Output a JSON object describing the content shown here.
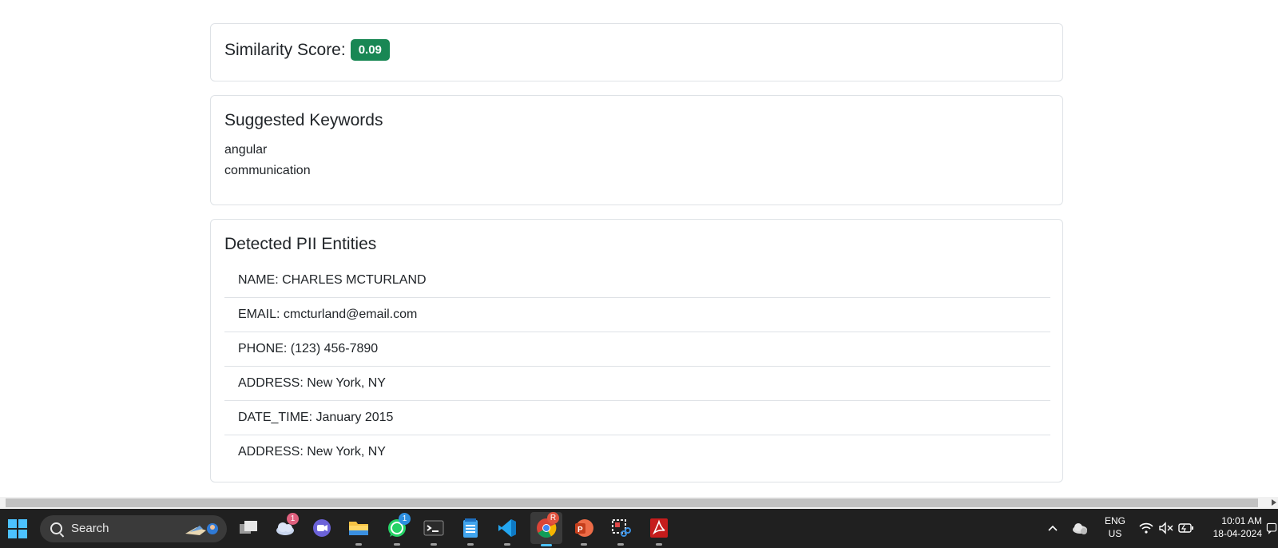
{
  "score_card": {
    "label": "Similarity Score:",
    "value": "0.09",
    "badge_color": "#198754"
  },
  "keywords_card": {
    "title": "Suggested Keywords",
    "items": [
      "angular",
      "communication"
    ]
  },
  "pii_card": {
    "title": "Detected PII Entities",
    "items": [
      "NAME: CHARLES MCTURLAND",
      "EMAIL: cmcturland@email.com",
      "PHONE: (123) 456-7890",
      "ADDRESS: New York, NY",
      "DATE_TIME: January 2015",
      "ADDRESS: New York, NY"
    ]
  },
  "taskbar": {
    "search_placeholder": "Search",
    "apps": [
      {
        "name": "task-view-icon"
      },
      {
        "name": "weather-icon",
        "badge": "1"
      },
      {
        "name": "meet-icon"
      },
      {
        "name": "file-explorer-icon"
      },
      {
        "name": "whatsapp-icon",
        "badge": "1"
      },
      {
        "name": "terminal-icon"
      },
      {
        "name": "notepad-icon"
      },
      {
        "name": "vscode-icon"
      },
      {
        "name": "chrome-icon",
        "badge": "R"
      },
      {
        "name": "powerpoint-icon"
      },
      {
        "name": "snipping-tool-icon"
      },
      {
        "name": "acrobat-icon"
      }
    ],
    "language": {
      "line1": "ENG",
      "line2": "US"
    },
    "time": "10:01 AM",
    "date": "18-04-2024"
  }
}
